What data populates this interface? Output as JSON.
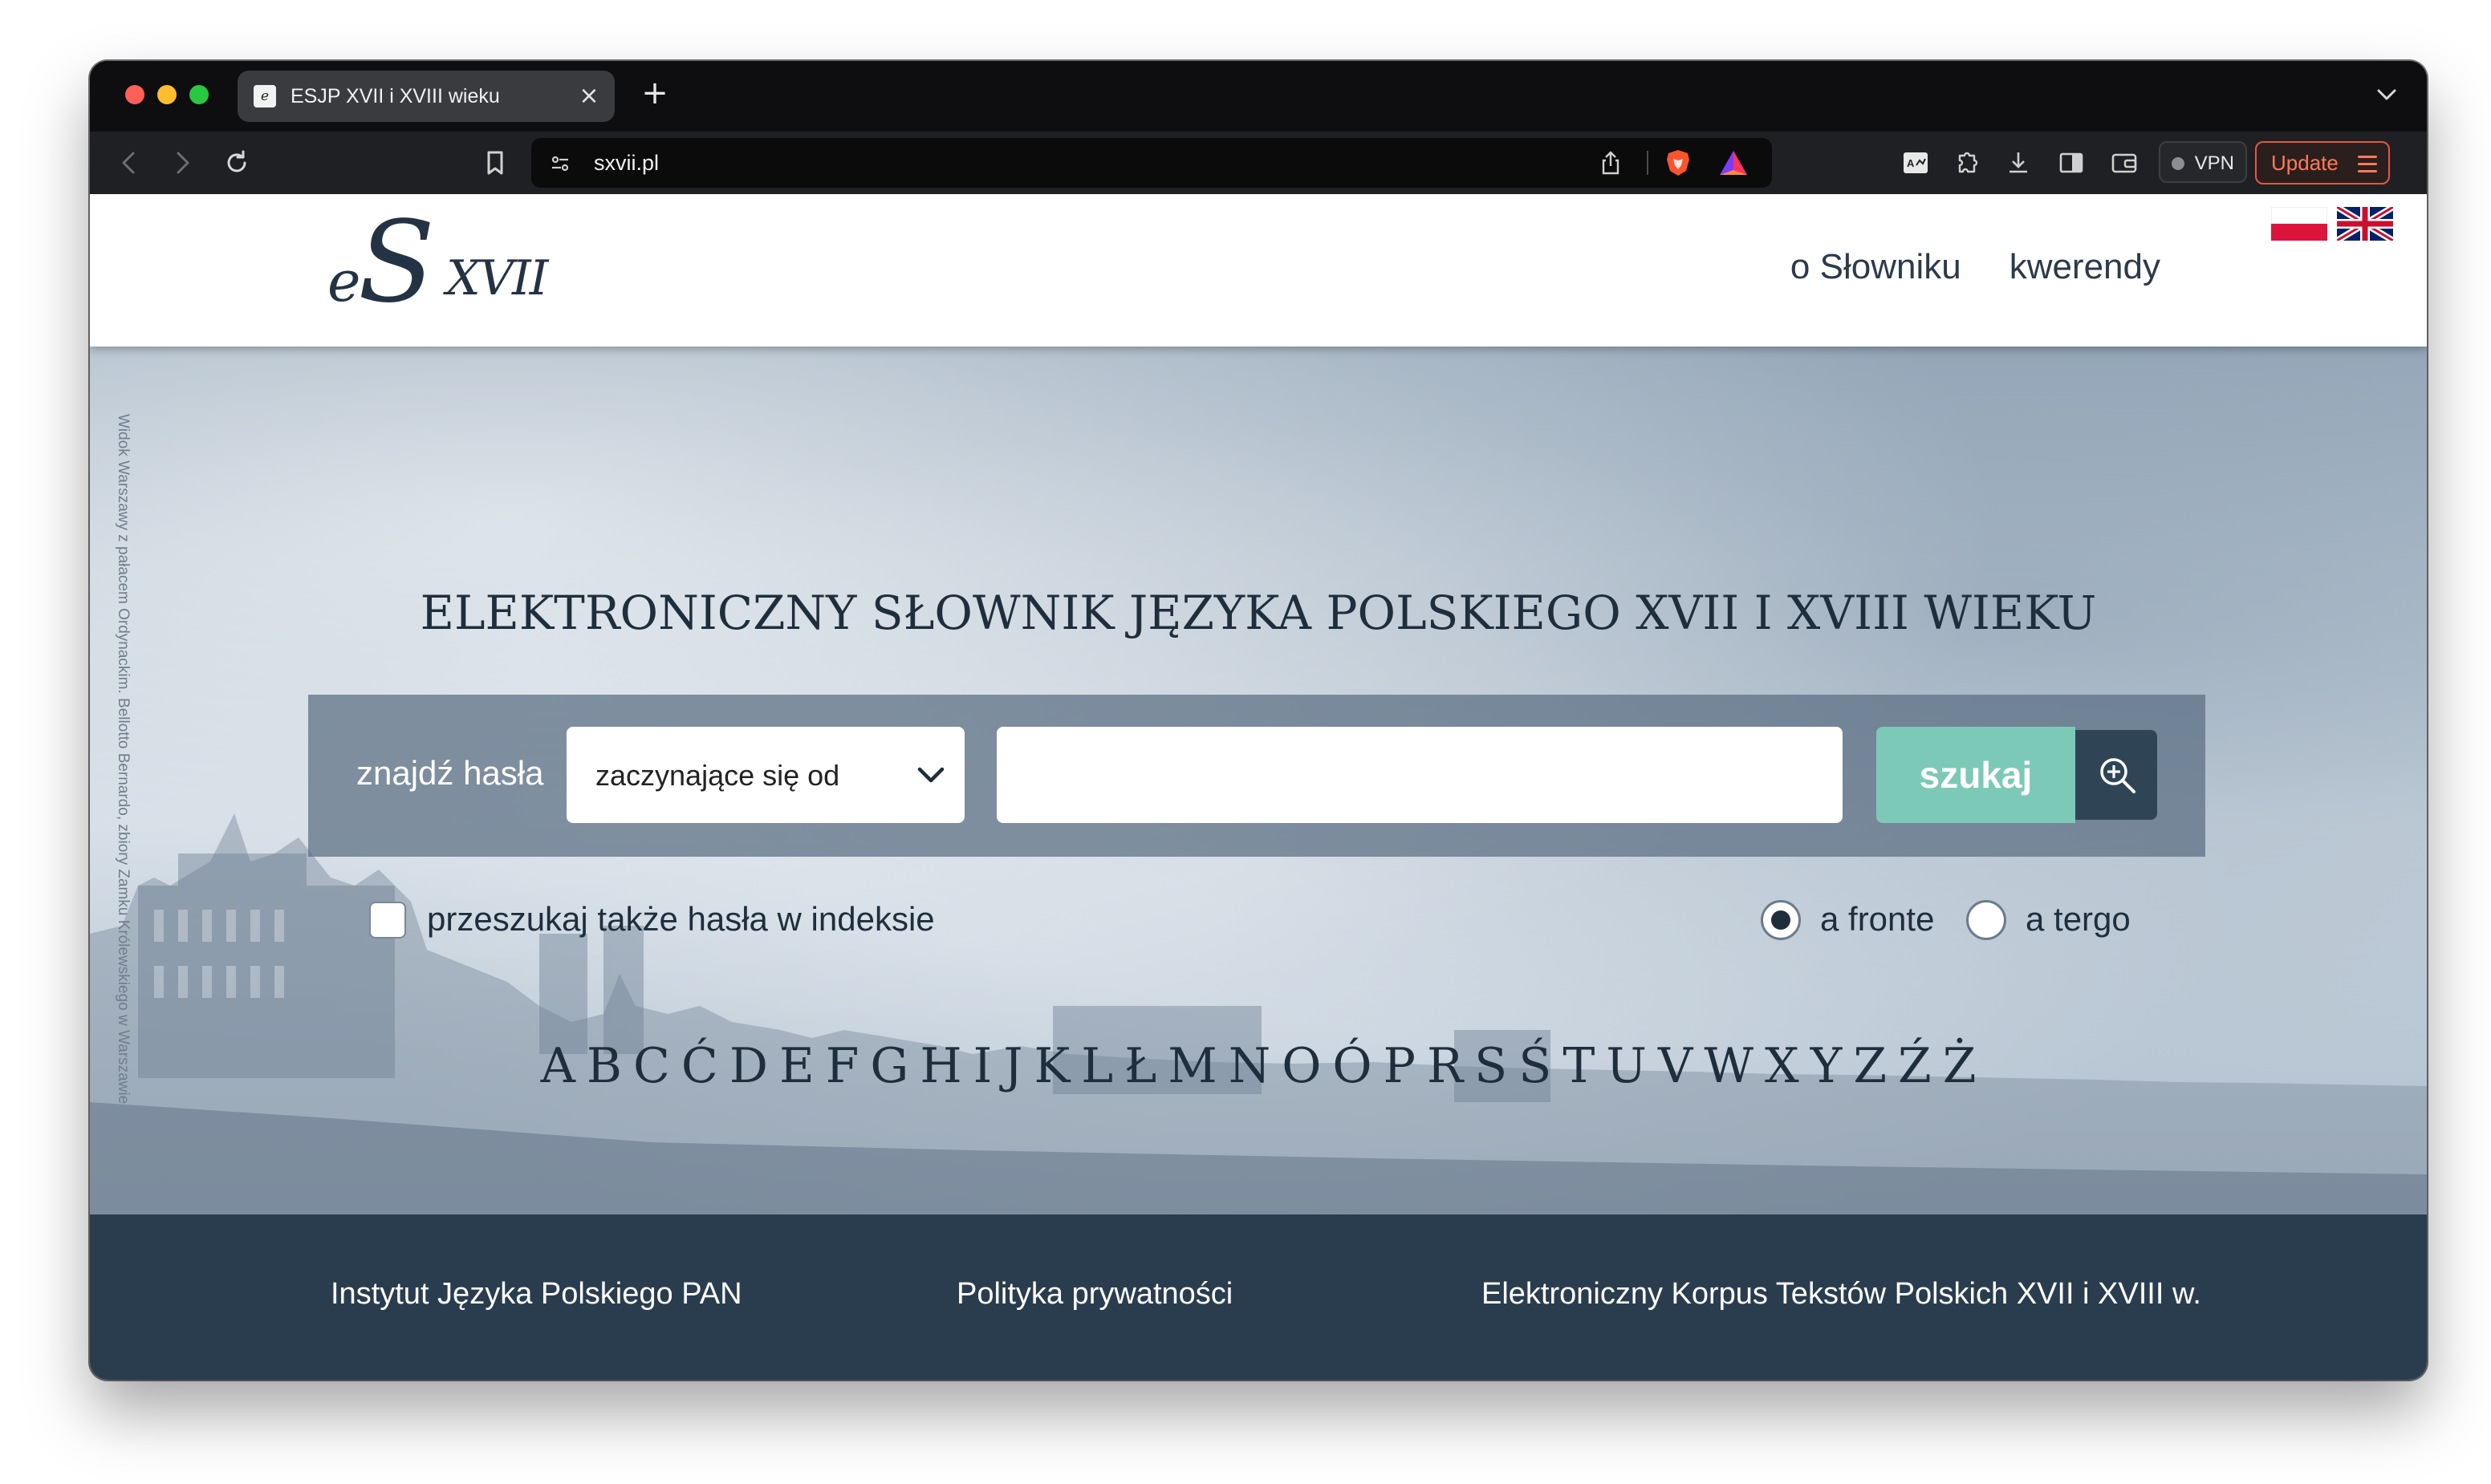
{
  "browser": {
    "tab_title": "ESJP XVII i XVIII wieku",
    "tab_close": "×",
    "new_tab": "+",
    "url": "sxvii.pl",
    "vpn_label": "VPN",
    "update_label": "Update",
    "icons": [
      "back-icon",
      "forward-icon",
      "reload-icon",
      "bookmark-icon",
      "site-settings-icon",
      "share-icon",
      "brave-shields-icon",
      "brave-rewards-icon",
      "reader-icon",
      "extensions-icon",
      "download-icon",
      "sidebar-icon",
      "wallet-icon",
      "tab-menu-icon"
    ]
  },
  "site": {
    "logo": {
      "e": "e",
      "s": "S",
      "xvii": "XVII"
    },
    "nav": [
      "o Słowniku",
      "kwerendy"
    ],
    "languages": [
      "pl",
      "en"
    ],
    "side_caption": "Widok Warszawy z pałacem Ordynackim. Bellotto Bernardo, zbiory Zamku Królewskiego w Warszawie",
    "title": "ELEKTRONICZNY SŁOWNIK JĘZYKA POLSKIEGO XVII I XVIII WIEKU",
    "search": {
      "label": "znajdź hasła",
      "mode_selected": "zaczynające się od",
      "query_value": "",
      "button": "szukaj",
      "advanced_icon": "zoom-in-icon"
    },
    "options": {
      "index_checkbox_label": "przeszukaj także hasła w indeksie",
      "index_checkbox_checked": false,
      "radio_front": "a fronte",
      "radio_tergo": "a tergo",
      "selected_radio": "a fronte"
    },
    "alphabet": [
      "A",
      "B",
      "C",
      "Ć",
      "D",
      "E",
      "F",
      "G",
      "H",
      "I",
      "J",
      "K",
      "L",
      "Ł",
      "M",
      "N",
      "O",
      "Ó",
      "P",
      "R",
      "S",
      "Ś",
      "T",
      "U",
      "V",
      "W",
      "X",
      "Y",
      "Z",
      "Ź",
      "Ż"
    ],
    "footer_links": [
      "Instytut Języka Polskiego PAN",
      "Polityka prywatności",
      "Elektroniczny Korpus Tekstów Polskich XVII i XVIII w."
    ]
  },
  "colors": {
    "accent_button": "#7dc9b8",
    "footer_bg": "#2a3d4f",
    "update_accent": "#ff7a5c"
  }
}
